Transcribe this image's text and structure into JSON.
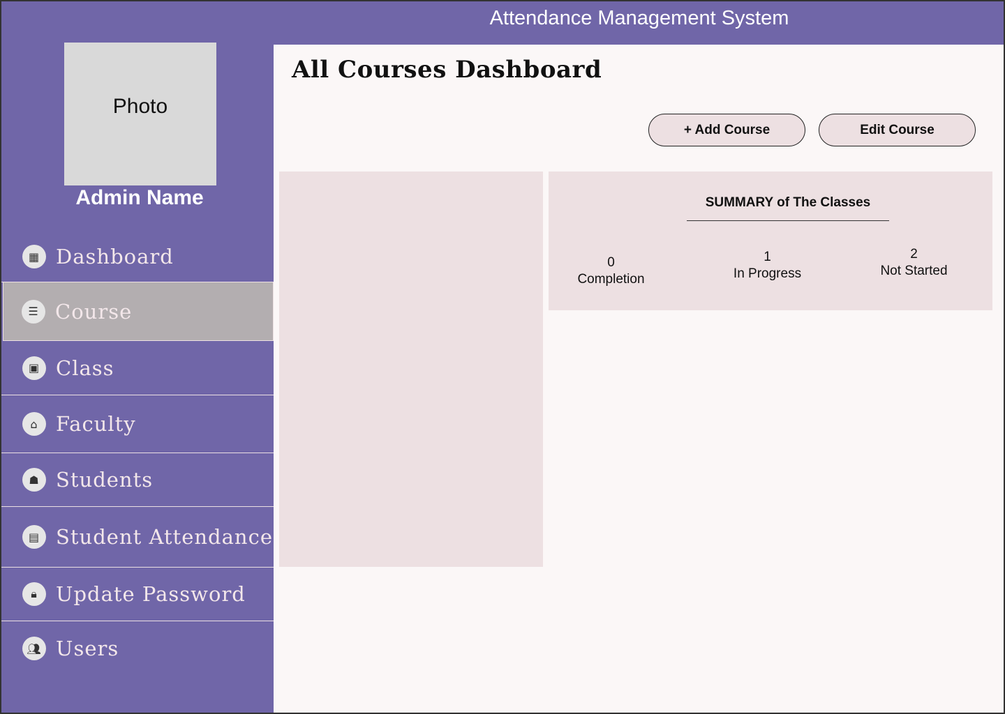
{
  "header": {
    "title": "Attendance Management System"
  },
  "profile": {
    "photo_label": "Photo",
    "admin_name": "Admin Name"
  },
  "nav": {
    "items": [
      {
        "label": "Dashboard",
        "icon": "dashboard-icon"
      },
      {
        "label": "Course",
        "icon": "course-list-icon",
        "active": true
      },
      {
        "label": "Class",
        "icon": "class-icon"
      },
      {
        "label": "Faculty",
        "icon": "faculty-icon"
      },
      {
        "label": "Students",
        "icon": "students-icon"
      },
      {
        "label": "Student Attendance",
        "icon": "attendance-icon"
      },
      {
        "label": "Update Password",
        "icon": "lock-icon"
      },
      {
        "label": "Users",
        "icon": "users-icon"
      }
    ]
  },
  "main": {
    "title": "All Courses Dashboard",
    "add_button": "+ Add Course",
    "edit_button": "Edit Course"
  },
  "summary": {
    "title": "SUMMARY of The Classes",
    "stats": [
      {
        "value": "0",
        "label": "Completion"
      },
      {
        "value": "1",
        "label": "In Progress"
      },
      {
        "value": "2",
        "label": "Not Started"
      }
    ]
  },
  "colors": {
    "sidebar": "#7066a8",
    "active_item": "#b3aeb0",
    "panel": "#ede0e2",
    "main_bg": "#fbf7f7"
  }
}
